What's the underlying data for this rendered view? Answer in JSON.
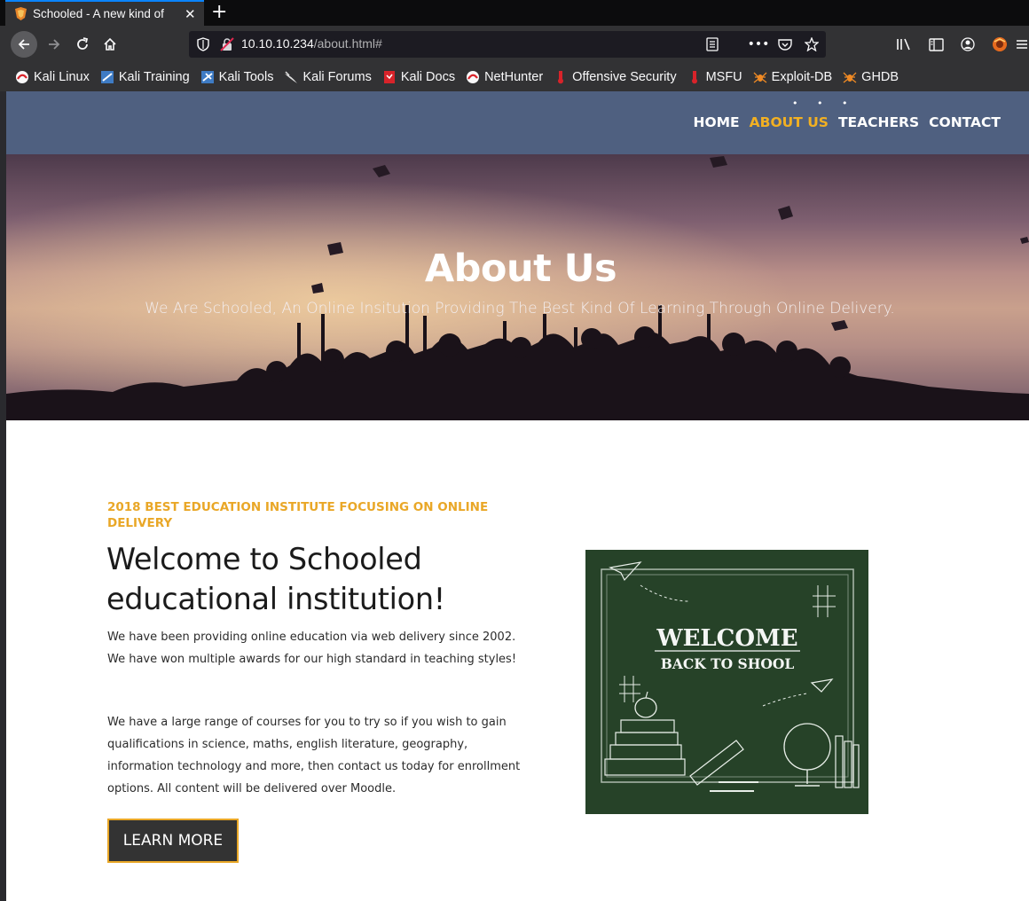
{
  "browser": {
    "tab_title": "Schooled - A new kind of",
    "url_host": "10.10.10.234",
    "url_path": "/about.html#",
    "bookmarks": [
      {
        "label": "Kali Linux",
        "icon": "kali-icon"
      },
      {
        "label": "Kali Training",
        "icon": "kali-training-icon"
      },
      {
        "label": "Kali Tools",
        "icon": "kali-tools-icon"
      },
      {
        "label": "Kali Forums",
        "icon": "kali-dragon-icon"
      },
      {
        "label": "Kali Docs",
        "icon": "kali-docs-icon"
      },
      {
        "label": "NetHunter",
        "icon": "kali-icon"
      },
      {
        "label": "Offensive Security",
        "icon": "offsec-icon"
      },
      {
        "label": "MSFU",
        "icon": "offsec-icon"
      },
      {
        "label": "Exploit-DB",
        "icon": "spider-icon"
      },
      {
        "label": "GHDB",
        "icon": "spider-icon"
      }
    ]
  },
  "site": {
    "nav": {
      "home": "HOME",
      "about": "ABOUT US",
      "teachers": "TEACHERS",
      "contact": "CONTACT"
    },
    "hero": {
      "title": "About Us",
      "subtitle": "We Are Schooled, An Online Insitution Providing The Best Kind Of Learning Through Online Delivery."
    },
    "about": {
      "eyebrow": "2018 BEST EDUCATION INSTITUTE FOCUSING ON ONLINE DELIVERY",
      "heading": "Welcome to Schooled educational institution!",
      "paragraph1": "We have been providing online education via web delivery since 2002. We have won multiple awards for our high standard in teaching styles!",
      "paragraph2": "We have a large range of courses for you to try so if you wish to gain qualifications in science, maths, english literature, geography, information technology and more, then contact us today for enrollment options. All content will be delivered over Moodle.",
      "button": "LEARN MORE"
    },
    "chalkboard": {
      "line1": "WELCOME",
      "line2": "BACK TO SHOOL"
    }
  },
  "colors": {
    "header_bg": "#4f6080",
    "accent": "#e9a727",
    "button_bg": "#333333",
    "chalkboard": "#2c4a2e"
  }
}
